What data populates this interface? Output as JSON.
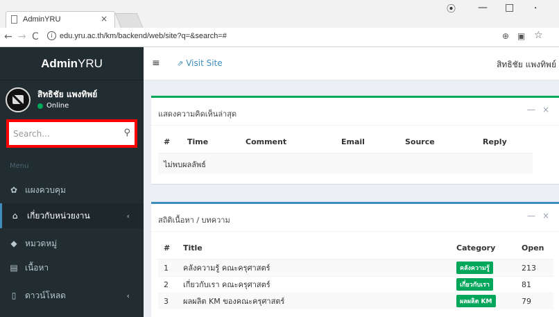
{
  "browser": {
    "tab_title": "AdminYRU",
    "tab_close": "×",
    "url": "edu.yru.ac.th/km/backend/web/site?q=&search=#",
    "info_icon_glyph": "i",
    "nav_back": "←",
    "nav_forward": "→",
    "nav_reload": "C",
    "win_user": "⦿",
    "win_min": "—",
    "win_max": "□",
    "win_close": "⸱"
  },
  "header": {
    "logo_bold": "Admin",
    "logo_rest": "YRU",
    "hamburger": "≡",
    "visit_site_icon": "⇗",
    "visit_site": "Visit Site",
    "user_name": "สิทธิชัย แพงทิพย์"
  },
  "sidebar": {
    "user_name": "สิทธิชัย แพงทิพย์",
    "status": "Online",
    "status_color": "#00a65a",
    "search_placeholder": "Search...",
    "search_icon_glyph": "🔍",
    "menu_header": "Menu",
    "items": [
      {
        "label": "แผงควบคุม",
        "icon": "tachometer-icon",
        "glyph": "⛭",
        "has_chevron": false
      },
      {
        "label": "เกี่ยวกับหน่วยงาน",
        "icon": "bank-icon",
        "glyph": "🏛",
        "has_chevron": true,
        "active": true
      },
      {
        "label": "หมวดหมู่",
        "icon": "tag-icon",
        "glyph": "🏷",
        "has_chevron": false
      },
      {
        "label": "เนื้อหา",
        "icon": "newspaper-icon",
        "glyph": "📰",
        "has_chevron": false
      },
      {
        "label": "ดาวน์โหลด",
        "icon": "file-icon",
        "glyph": "🗋",
        "has_chevron": true
      }
    ],
    "chevron": "‹"
  },
  "comments_box": {
    "title": "แสดงความคิดเห็นล่าสุด",
    "tool_min": "—",
    "tool_close": "×",
    "columns": [
      "#",
      "Time",
      "Comment",
      "Email",
      "Source",
      "Reply"
    ],
    "empty_text": "ไม่พบผลลัพธ์"
  },
  "stats_box": {
    "title": "สถิติเนื้อหา / บทความ",
    "tool_min": "—",
    "tool_close": "×",
    "columns": [
      "#",
      "Title",
      "Category",
      "Open"
    ],
    "rows": [
      {
        "num": "1",
        "title": "คลังความรู้ คณะครุศาสตร์",
        "category": "คลังความรู้",
        "open": "213"
      },
      {
        "num": "2",
        "title": "เกี่ยวกับเรา คณะครุศาสตร์",
        "category": "เกี่ยวกับเรา",
        "open": "81"
      },
      {
        "num": "3",
        "title": "ผลผลิต KM ของคณะครุศาสตร์",
        "category": "ผลผลิต KM",
        "open": "79"
      }
    ],
    "category_color": "#00a65a"
  },
  "colors": {
    "sidebar_bg": "#222d32",
    "accent_blue": "#3c8dbc",
    "accent_green": "#00a65a",
    "search_highlight": "#ff0000"
  }
}
